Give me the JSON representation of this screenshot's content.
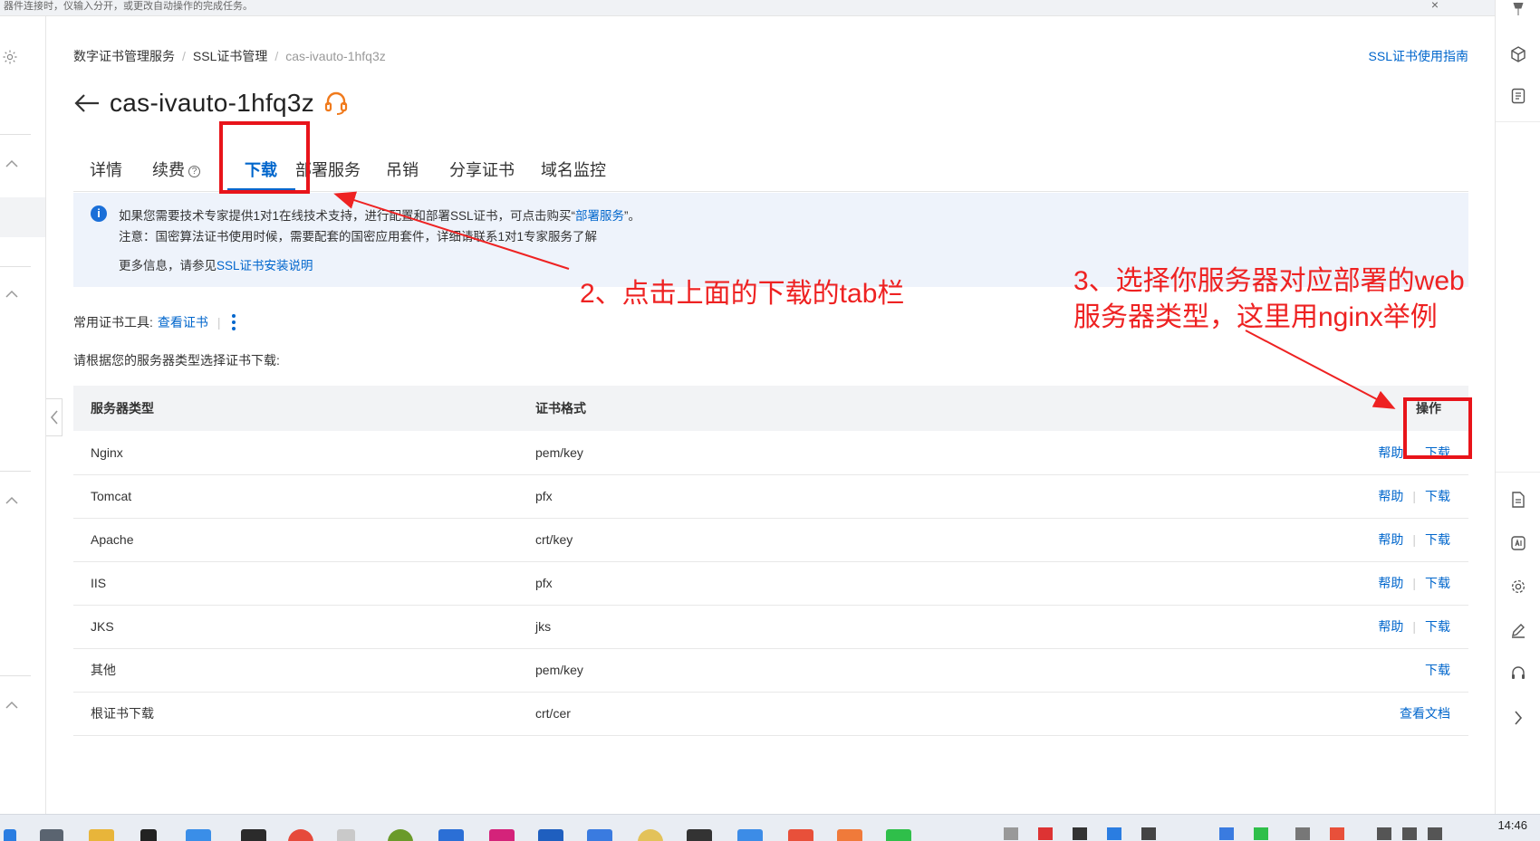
{
  "top_strip": {
    "text": "器件连接时，仪输入分开，或更改自动操作的完成任务。",
    "close": "×"
  },
  "breadcrumb": {
    "items": [
      "数字证书管理服务",
      "SSL证书管理"
    ],
    "current": "cas-ivauto-1hfq3z"
  },
  "guide_link": "SSL证书使用指南",
  "title": "cas-ivauto-1hfq3z",
  "tabs": [
    "详情",
    "续费",
    "下载",
    "部署服务",
    "吊销",
    "分享证书",
    "域名监控"
  ],
  "tab_help_mark": "?",
  "notice": {
    "info_glyph": "i",
    "line1_prefix": "如果您需要技术专家提供1对1在线技术支持，进行配置和部署SSL证书，可点击购买“",
    "line1_link": "部署服务",
    "line1_suffix": "”。",
    "line2": "注意：国密算法证书使用时候，需要配套的国密应用套件，详细请联系1对1专家服务了解",
    "line3_prefix": "更多信息，请参见",
    "line3_link": "SSL证书安装说明"
  },
  "tools": {
    "label": "常用证书工具:",
    "link": "查看证书",
    "separator": "|"
  },
  "prompt": "请根据您的服务器类型选择证书下载:",
  "table": {
    "headers": {
      "server_type": "服务器类型",
      "format": "证书格式",
      "action": "操作"
    },
    "rows": [
      {
        "server": "Nginx",
        "format": "pem/key",
        "help": "帮助",
        "download": "下载",
        "show_pipe": false
      },
      {
        "server": "Tomcat",
        "format": "pfx",
        "help": "帮助",
        "download": "下载",
        "show_pipe": true
      },
      {
        "server": "Apache",
        "format": "crt/key",
        "help": "帮助",
        "download": "下载",
        "show_pipe": true
      },
      {
        "server": "IIS",
        "format": "pfx",
        "help": "帮助",
        "download": "下载",
        "show_pipe": true
      },
      {
        "server": "JKS",
        "format": "jks",
        "help": "帮助",
        "download": "下载",
        "show_pipe": true
      },
      {
        "server": "其他",
        "format": "pem/key",
        "help": "",
        "download": "下载",
        "show_pipe": false
      },
      {
        "server": "根证书下载",
        "format": "crt/cer",
        "help": "",
        "download": "查看文档",
        "show_pipe": false
      }
    ],
    "pipe": "|"
  },
  "annotations": {
    "step2": "2、点击上面的下载的tab栏",
    "step3_line1": "3、选择你服务器对应部署的web",
    "step3_line2": "服务器类型，这里用nginx举例",
    "color": "#ee2222"
  },
  "taskbar": {
    "clock": "14:46"
  },
  "colors": {
    "link": "#0066cc",
    "accent_orange": "#f07a1c",
    "notice_bg": "#eef3fb",
    "annotation_red": "#e8141a"
  }
}
